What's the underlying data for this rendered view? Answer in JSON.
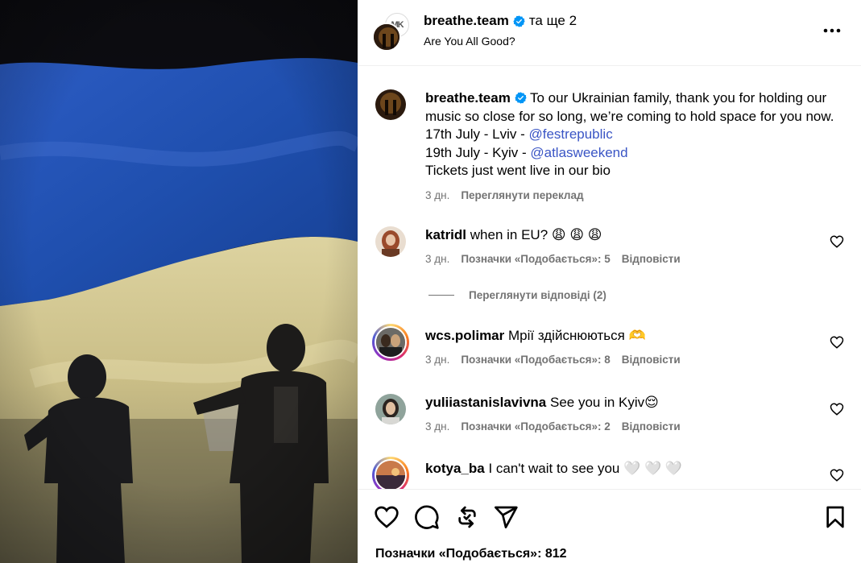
{
  "header": {
    "username": "breathe.team",
    "coauthors": "та ще 2",
    "subtitle": "Are You All Good?",
    "second_avatar_text": "MK"
  },
  "caption": {
    "username": "breathe.team",
    "text_1": "To our Ukrainian family, thank you for holding our music so close for so long, we’re coming to hold space for you now.",
    "line_lviv": "17th July - Lviv - ",
    "mention_lviv": "@festrepublic",
    "line_kyiv": "19th July - Kyiv - ",
    "mention_kyiv": "@atlasweekend",
    "line_tickets": "Tickets just went live in our bio",
    "time": "3 дн.",
    "translate": "Переглянути переклад"
  },
  "comments": [
    {
      "username": "katridl",
      "text": "when in EU?",
      "emoji": "😩 😩 😩",
      "time": "3 дн.",
      "likes": "Позначки «Подобається»: 5",
      "reply": "Відповісти"
    },
    {
      "username": "wcs.polimar",
      "text": "Мрії здійснюються",
      "emoji": "🫶",
      "time": "3 дн.",
      "likes": "Позначки «Подобається»: 8",
      "reply": "Відповісти"
    },
    {
      "username": "yuliiastanislavivna",
      "text": "See you in Kyiv",
      "emoji": "😌",
      "time": "3 дн.",
      "likes": "Позначки «Подобається»: 2",
      "reply": "Відповісти"
    },
    {
      "username": "kotya_ba",
      "text": "I can't wait to see you",
      "emoji": "🤍 🤍 🤍",
      "time": "",
      "likes": "",
      "reply": ""
    }
  ],
  "replies_toggle": "Переглянути відповіді (2)",
  "footer": {
    "likes": "Позначки «Подобається»: 812"
  },
  "colors": {
    "flag_blue": "#1f4fae",
    "flag_yellow": "#cfc48a",
    "link": "#3a55c5",
    "secondary_text": "#737373",
    "verified": "#0095f6"
  },
  "icons": [
    "more-options-icon",
    "verified-badge-icon",
    "heart-icon",
    "comment-icon",
    "repost-icon",
    "share-icon",
    "save-icon"
  ]
}
